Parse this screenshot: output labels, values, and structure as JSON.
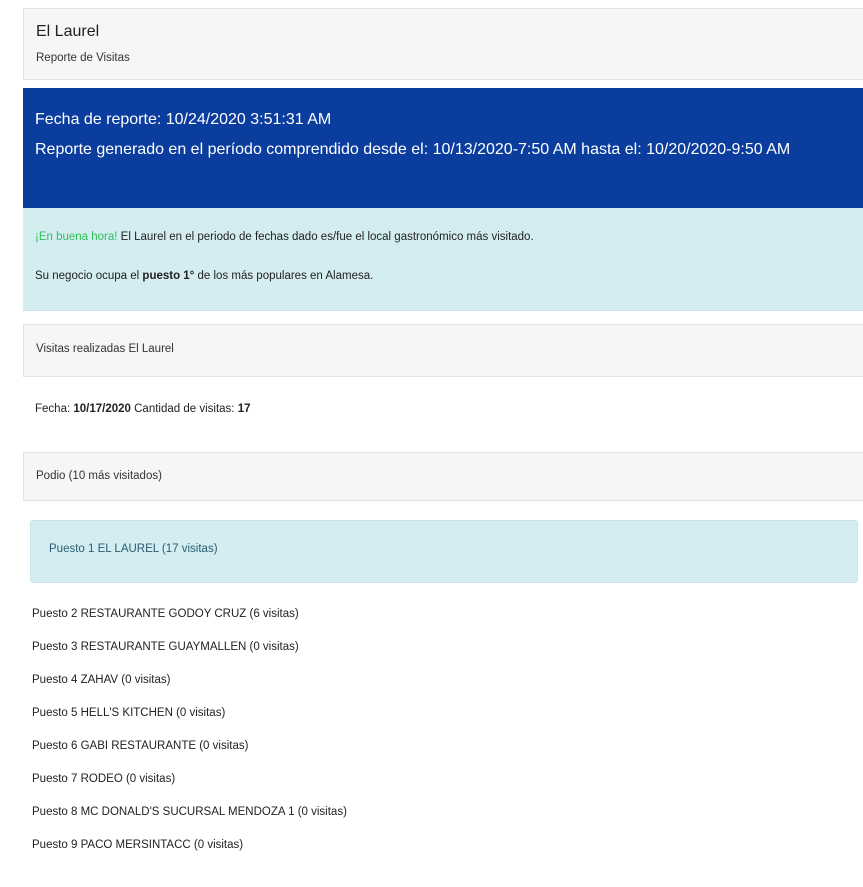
{
  "header": {
    "title": "El Laurel",
    "subtitle": "Reporte de Visitas"
  },
  "report": {
    "date_line": "Fecha de reporte: 10/24/2020 3:51:31 AM",
    "period_line": "Reporte generado en el período comprendido desde el: 10/13/2020-7:50 AM hasta el: 10/20/2020-9:50 AM"
  },
  "info": {
    "highlight": "¡En buena hora!",
    "message_rest": " El Laurel en el periodo de fechas dado es/fue el local gastronómico más visitado.",
    "rank_prefix": "Su negocio ocupa el ",
    "rank_value": "puesto 1°",
    "rank_suffix": " de los más populares en Alamesa."
  },
  "visits": {
    "section_title": "Visitas realizadas El Laurel",
    "date_label": "Fecha: ",
    "date_value": "10/17/2020",
    "count_label": " Cantidad de visitas: ",
    "count_value": "17"
  },
  "podium": {
    "section_title": "Podio (10 más visitados)",
    "items": [
      "Puesto 1 EL LAUREL (17 visitas)",
      "Puesto 2 RESTAURANTE GODOY CRUZ (6 visitas)",
      "Puesto 3 RESTAURANTE GUAYMALLEN (0 visitas)",
      "Puesto 4 ZAHAV (0 visitas)",
      "Puesto 5 HELL'S KITCHEN (0 visitas)",
      "Puesto 6 GABI RESTAURANTE (0 visitas)",
      "Puesto 7 RODEO (0 visitas)",
      "Puesto 8 MC DONALD'S SUCURSAL MENDOZA 1 (0 visitas)",
      "Puesto 9 PACO MERSINTACC (0 visitas)"
    ]
  },
  "colors": {
    "blue_panel": "#0a3d9e",
    "info_panel": "#d3edf1",
    "highlight_green": "#2fbf5a"
  }
}
